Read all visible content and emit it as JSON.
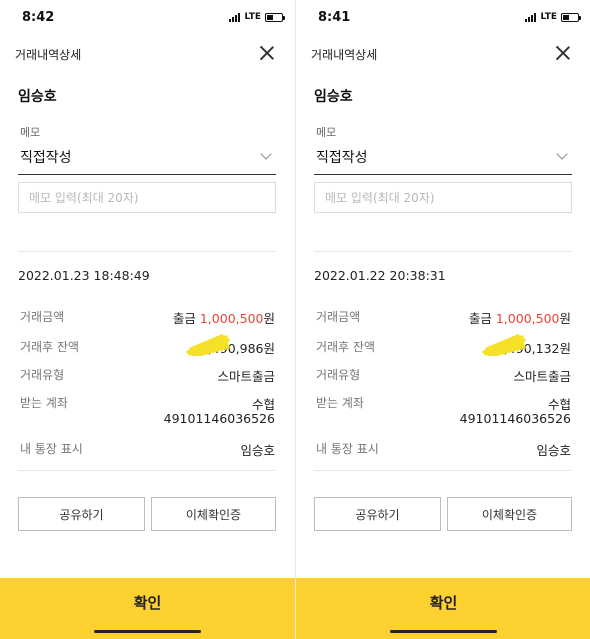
{
  "screens": [
    {
      "status": {
        "time": "8:42",
        "network": "LTE"
      },
      "header": {
        "title": "거래내역상세"
      },
      "recipient_name": "임승호",
      "memo": {
        "label": "메모",
        "selected": "직접작성",
        "placeholder": "메모 입력(최대 20자)",
        "value": ""
      },
      "datetime": "2022.01.23 18:48:49",
      "details": {
        "amount": {
          "label": "거래금액",
          "prefix": "출금 ",
          "value": "1,000,500",
          "unit": "원"
        },
        "balance": {
          "label": "거래후 잔액",
          "value": "1,490,986원"
        },
        "type": {
          "label": "거래유형",
          "value": "스마트출금"
        },
        "account": {
          "label": "받는 계좌",
          "bank": "수협",
          "number": "49101146036526"
        },
        "display": {
          "label": "내 통장 표시",
          "value": "임승호"
        }
      },
      "buttons": {
        "share": "공유하기",
        "certificate": "이체확인증"
      },
      "confirm": "확인"
    },
    {
      "status": {
        "time": "8:41",
        "network": "LTE"
      },
      "header": {
        "title": "거래내역상세"
      },
      "recipient_name": "임승호",
      "memo": {
        "label": "메모",
        "selected": "직접작성",
        "placeholder": "메모 입력(최대 20자)",
        "value": ""
      },
      "datetime": "2022.01.22 20:38:31",
      "details": {
        "amount": {
          "label": "거래금액",
          "prefix": "출금 ",
          "value": "1,000,500",
          "unit": "원"
        },
        "balance": {
          "label": "거래후 잔액",
          "value": "2,490,132원"
        },
        "type": {
          "label": "거래유형",
          "value": "스마트출금"
        },
        "account": {
          "label": "받는 계좌",
          "bank": "수협",
          "number": "49101146036526"
        },
        "display": {
          "label": "내 통장 표시",
          "value": "임승호"
        }
      },
      "buttons": {
        "share": "공유하기",
        "certificate": "이체확인증"
      },
      "confirm": "확인"
    }
  ],
  "colors": {
    "accent_yellow": "#fdd12f",
    "amount_red": "#e8413a",
    "redaction_yellow": "#f5e02a"
  }
}
